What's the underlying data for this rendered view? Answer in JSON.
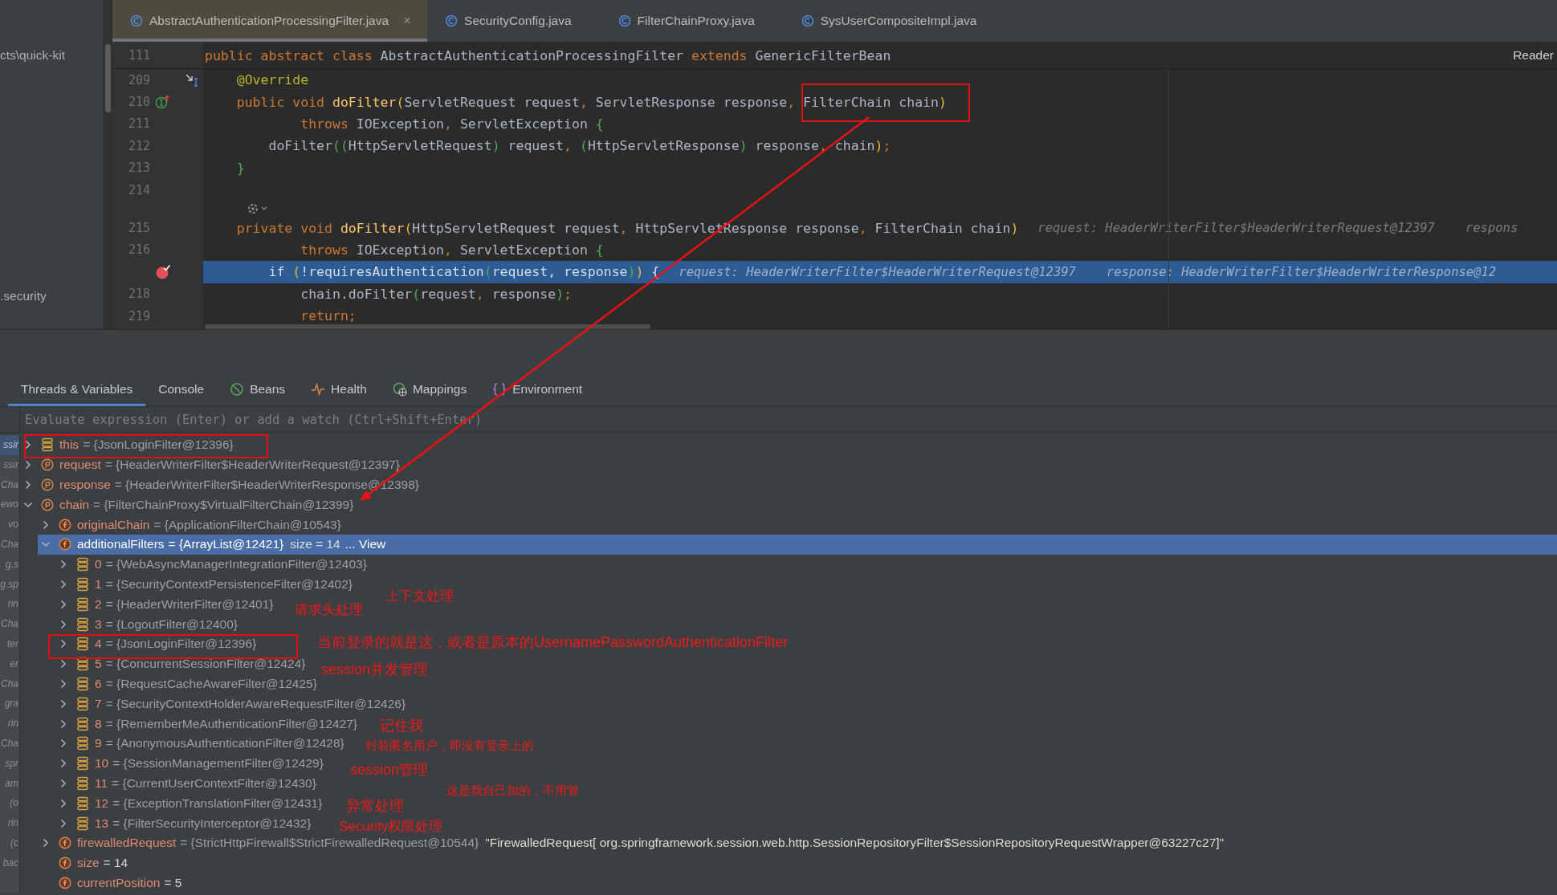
{
  "project_tree": [
    {
      "label": "cts\\quick-kit"
    },
    {
      "label": ".security"
    }
  ],
  "editor_tabs": [
    {
      "label": "AbstractAuthenticationProcessingFilter.java",
      "selected": true,
      "close": "×"
    },
    {
      "label": "SecurityConfig.java",
      "selected": false
    },
    {
      "label": "FilterChainProxy.java",
      "selected": false
    },
    {
      "label": "SysUserCompositeImpl.java",
      "selected": false
    }
  ],
  "sticky_line": {
    "number": "111",
    "tokens": [
      {
        "text": "public abstract class ",
        "kind": "keyword"
      },
      {
        "text": "AbstractAuthenticationProcessingFilter ",
        "kind": "plain"
      },
      {
        "text": "extends ",
        "kind": "keyword"
      },
      {
        "text": "GenericFilterBean",
        "kind": "plain"
      }
    ]
  },
  "reader_mode": "Reader",
  "code_lines": [
    {
      "kind": "code",
      "number": "209",
      "marker": {
        "kind": "jump"
      },
      "current": false,
      "tokens": [
        {
          "text": "    @Override",
          "kind": "annotation"
        }
      ]
    },
    {
      "kind": "code",
      "number": "210",
      "marker": {
        "kind": "implements"
      },
      "current": false,
      "tokens": [
        {
          "text": "    public void ",
          "kind": "keyword"
        },
        {
          "text": "doFilter",
          "kind": "method"
        },
        {
          "text": "(",
          "kind": "bracket"
        },
        {
          "text": "ServletRequest request",
          "kind": "plain"
        },
        {
          "text": ", ",
          "kind": "keyword"
        },
        {
          "text": "ServletResponse response",
          "kind": "plain"
        },
        {
          "text": ", ",
          "kind": "keyword"
        },
        {
          "text": "FilterChain chain",
          "kind": "plain"
        },
        {
          "text": ")",
          "kind": "bracket"
        }
      ]
    },
    {
      "kind": "code",
      "number": "211",
      "current": false,
      "tokens": [
        {
          "text": "            throws ",
          "kind": "keyword"
        },
        {
          "text": "IOException",
          "kind": "plain"
        },
        {
          "text": ", ",
          "kind": "keyword"
        },
        {
          "text": "ServletException ",
          "kind": "plain"
        },
        {
          "text": "{",
          "kind": "brace"
        }
      ]
    },
    {
      "kind": "code",
      "number": "212",
      "current": false,
      "tokens": [
        {
          "text": "        doFilter",
          "kind": "plain"
        },
        {
          "text": "((",
          "kind": "brace"
        },
        {
          "text": "HttpServletRequest",
          "kind": "plain"
        },
        {
          "text": ")",
          "kind": "brace"
        },
        {
          "text": " request",
          "kind": "plain"
        },
        {
          "text": ", ",
          "kind": "keyword"
        },
        {
          "text": "(",
          "kind": "brace"
        },
        {
          "text": "HttpServletResponse",
          "kind": "plain"
        },
        {
          "text": ")",
          "kind": "brace"
        },
        {
          "text": " response",
          "kind": "plain"
        },
        {
          "text": ", ",
          "kind": "keyword"
        },
        {
          "text": "chain",
          "kind": "plain"
        },
        {
          "text": ")",
          "kind": "bracket"
        },
        {
          "text": ";",
          "kind": "keyword"
        }
      ]
    },
    {
      "kind": "code",
      "number": "213",
      "current": false,
      "tokens": [
        {
          "text": "    }",
          "kind": "brace"
        }
      ]
    },
    {
      "kind": "code",
      "number": "214",
      "current": false
    },
    {
      "kind": "inlay"
    },
    {
      "kind": "code",
      "number": "215",
      "current": false,
      "tokens": [
        {
          "text": "    private void ",
          "kind": "keyword"
        },
        {
          "text": "doFilter",
          "kind": "method"
        },
        {
          "text": "(",
          "kind": "bracket"
        },
        {
          "text": "HttpServletRequest request",
          "kind": "plain"
        },
        {
          "text": ", ",
          "kind": "keyword"
        },
        {
          "text": "HttpServletResponse response",
          "kind": "plain"
        },
        {
          "text": ", ",
          "kind": "keyword"
        },
        {
          "text": "FilterChain chain",
          "kind": "plain"
        },
        {
          "text": ")",
          "kind": "bracket"
        }
      ],
      "hints": [
        "request: HeaderWriterFilter$HeaderWriterRequest@12397",
        "respons"
      ]
    },
    {
      "kind": "code",
      "number": "216",
      "current": false,
      "tokens": [
        {
          "text": "            throws ",
          "kind": "keyword"
        },
        {
          "text": "IOException",
          "kind": "plain"
        },
        {
          "text": ", ",
          "kind": "keyword"
        },
        {
          "text": "ServletException ",
          "kind": "plain"
        },
        {
          "text": "{",
          "kind": "brace"
        }
      ]
    },
    {
      "kind": "code",
      "marker": {
        "kind": "breakpoint"
      },
      "current": true,
      "tokens": [
        {
          "text": "        if ",
          "kind": "keyword"
        },
        {
          "text": "(",
          "kind": "bracket"
        },
        {
          "text": "!requiresAuthentication",
          "kind": "plain"
        },
        {
          "text": "(",
          "kind": "brace"
        },
        {
          "text": "request",
          "kind": "plain"
        },
        {
          "text": ", ",
          "kind": "keyword"
        },
        {
          "text": "response",
          "kind": "plain"
        },
        {
          "text": ")",
          "kind": "brace"
        },
        {
          "text": ")",
          "kind": "bracket"
        },
        {
          "text": " {",
          "kind": "plain"
        }
      ],
      "hints": [
        "request: HeaderWriterFilter$HeaderWriterRequest@12397",
        "response: HeaderWriterFilter$HeaderWriterResponse@12"
      ]
    },
    {
      "kind": "code",
      "number": "218",
      "current": false,
      "tokens": [
        {
          "text": "            chain.doFilter",
          "kind": "plain"
        },
        {
          "text": "(",
          "kind": "brace"
        },
        {
          "text": "request",
          "kind": "plain"
        },
        {
          "text": ", ",
          "kind": "keyword"
        },
        {
          "text": "response",
          "kind": "plain"
        },
        {
          "text": ")",
          "kind": "brace"
        },
        {
          "text": ";",
          "kind": "keyword"
        }
      ]
    },
    {
      "kind": "code",
      "number": "219",
      "current": false,
      "tokens": [
        {
          "text": "            return;",
          "kind": "keyword"
        }
      ]
    }
  ],
  "debug_tabs": [
    {
      "label": "Threads & Variables",
      "selected": true,
      "kind": "plain"
    },
    {
      "label": "Console",
      "selected": false,
      "kind": "plain"
    },
    {
      "label": "Beans",
      "selected": false,
      "kind": "beans"
    },
    {
      "label": "Health",
      "selected": false,
      "kind": "health"
    },
    {
      "label": "Mappings",
      "selected": false,
      "kind": "mappings"
    },
    {
      "label": "Environment",
      "selected": false,
      "kind": "environment"
    }
  ],
  "evaluate": {
    "placeholder": "Evaluate expression (Enter) or add a watch (Ctrl+Shift+Enter)"
  },
  "frames": [
    {
      "label": "ssir",
      "selected": true
    },
    {
      "label": "ssir",
      "selected": false
    },
    {
      "label": "Cha",
      "selected": false
    },
    {
      "label": "ewo",
      "selected": false
    },
    {
      "label": "vo",
      "selected": false
    },
    {
      "label": "Cha",
      "selected": false
    },
    {
      "label": "g.s",
      "selected": false
    },
    {
      "label": "g.sp",
      "selected": false
    },
    {
      "label": "rin",
      "selected": false
    },
    {
      "label": "Cha",
      "selected": false
    },
    {
      "label": "ter",
      "selected": false
    },
    {
      "label": "er",
      "selected": false
    },
    {
      "label": "Cha",
      "selected": false
    },
    {
      "label": "gra",
      "selected": false
    },
    {
      "label": "rin",
      "selected": false
    },
    {
      "label": "Cha",
      "selected": false
    },
    {
      "label": "spr",
      "selected": false
    },
    {
      "label": "am",
      "selected": false
    },
    {
      "label": "(o",
      "selected": false
    },
    {
      "label": "rin",
      "selected": false
    },
    {
      "label": "(c",
      "selected": false
    },
    {
      "label": "bac",
      "selected": false
    }
  ],
  "variables": [
    {
      "name": "this",
      "value": "= {JsonLoginFilter@12396}",
      "kind": "stack",
      "expanded": false,
      "selected": false
    },
    {
      "name": "request",
      "value": "= {HeaderWriterFilter$HeaderWriterRequest@12397}",
      "kind": "parameter",
      "expanded": false,
      "selected": false
    },
    {
      "name": "response",
      "value": "= {HeaderWriterFilter$HeaderWriterResponse@12398}",
      "kind": "parameter",
      "expanded": false,
      "selected": false
    },
    {
      "name": "chain",
      "value": "= {FilterChainProxy$VirtualFilterChain@12399}",
      "kind": "parameter",
      "expanded": true,
      "selected": false,
      "children": [
        {
          "name": "originalChain",
          "value": "= {ApplicationFilterChain@10543}",
          "kind": "field",
          "expanded": false,
          "selected": false
        },
        {
          "name": "additionalFilters",
          "value": "= {ArrayList@12421}",
          "extra": "size = 14",
          "link": "... View",
          "kind": "field",
          "expanded": true,
          "selected": true,
          "children": [
            {
              "name": "0",
              "value": "= {WebAsyncManagerIntegrationFilter@12403}",
              "kind": "stack",
              "expanded": false,
              "selected": false
            },
            {
              "name": "1",
              "value": "= {SecurityContextPersistenceFilter@12402}",
              "kind": "stack",
              "expanded": false,
              "selected": false
            },
            {
              "name": "2",
              "value": "= {HeaderWriterFilter@12401}",
              "kind": "stack",
              "expanded": false,
              "selected": false
            },
            {
              "name": "3",
              "value": "= {LogoutFilter@12400}",
              "kind": "stack",
              "expanded": false,
              "selected": false
            },
            {
              "name": "4",
              "value": "= {JsonLoginFilter@12396}",
              "kind": "stack",
              "expanded": false,
              "selected": false
            },
            {
              "name": "5",
              "value": "= {ConcurrentSessionFilter@12424}",
              "kind": "stack",
              "expanded": false,
              "selected": false
            },
            {
              "name": "6",
              "value": "= {RequestCacheAwareFilter@12425}",
              "kind": "stack",
              "expanded": false,
              "selected": false
            },
            {
              "name": "7",
              "value": "= {SecurityContextHolderAwareRequestFilter@12426}",
              "kind": "stack",
              "expanded": false,
              "selected": false
            },
            {
              "name": "8",
              "value": "= {RememberMeAuthenticationFilter@12427}",
              "kind": "stack",
              "expanded": false,
              "selected": false
            },
            {
              "name": "9",
              "value": "= {AnonymousAuthenticationFilter@12428}",
              "kind": "stack",
              "expanded": false,
              "selected": false
            },
            {
              "name": "10",
              "value": "= {SessionManagementFilter@12429}",
              "kind": "stack",
              "expanded": false,
              "selected": false
            },
            {
              "name": "11",
              "value": "= {CurrentUserContextFilter@12430}",
              "kind": "stack",
              "expanded": false,
              "selected": false
            },
            {
              "name": "12",
              "value": "= {ExceptionTranslationFilter@12431}",
              "kind": "stack",
              "expanded": false,
              "selected": false
            },
            {
              "name": "13",
              "value": "= {FilterSecurityInterceptor@12432}",
              "kind": "stack",
              "expanded": false,
              "selected": false
            }
          ]
        },
        {
          "name": "firewalledRequest",
          "value": "= {StrictHttpFirewall$StrictFirewalledRequest@10544}",
          "extra": "\"FirewalledRequest[ org.springframework.session.web.http.SessionRepositoryFilter$SessionRepositoryRequestWrapper@63227c27]\"",
          "kind": "field",
          "expanded": false,
          "selected": false
        },
        {
          "name": "size",
          "value": "= 14",
          "kind": "field",
          "selected": false
        },
        {
          "name": "currentPosition",
          "value": "= 5",
          "kind": "field",
          "selected": false
        }
      ]
    }
  ],
  "annotations": [
    {
      "text": "上下文处理"
    },
    {
      "text": "请求头处理"
    },
    {
      "text": "当前登录的就是这，或者是原本的UsernamePasswordAuthenticationFilter"
    },
    {
      "text": "session并发管理"
    },
    {
      "text": "记住我"
    },
    {
      "text": "封装匿名用户，即没有登录上的"
    },
    {
      "text": "session管理"
    },
    {
      "text": "这是我自己加的，不用管"
    },
    {
      "text": "异常处理"
    },
    {
      "text": "Security权限处理"
    }
  ]
}
